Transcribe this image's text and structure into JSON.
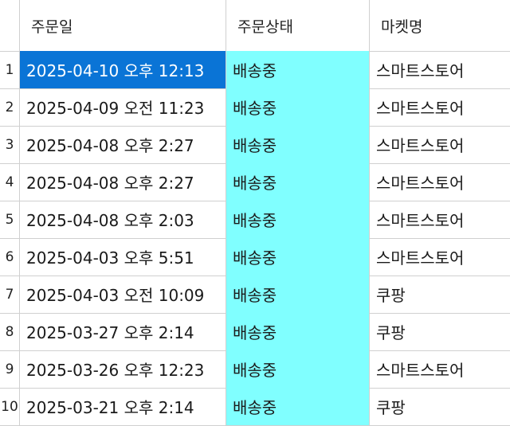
{
  "columns": {
    "index": "",
    "order_date": "주문일",
    "order_status": "주문상태",
    "market_name": "마켓명"
  },
  "selected_row": 0,
  "status_highlight_color": "#80ffff",
  "selection_color": "#0a74d6",
  "rows": [
    {
      "index": "1",
      "order_date": "2025-04-10 오후 12:13",
      "order_status": "배송중",
      "market_name": "스마트스토어"
    },
    {
      "index": "2",
      "order_date": "2025-04-09 오전 11:23",
      "order_status": "배송중",
      "market_name": "스마트스토어"
    },
    {
      "index": "3",
      "order_date": "2025-04-08 오후 2:27",
      "order_status": "배송중",
      "market_name": "스마트스토어"
    },
    {
      "index": "4",
      "order_date": "2025-04-08 오후 2:27",
      "order_status": "배송중",
      "market_name": "스마트스토어"
    },
    {
      "index": "5",
      "order_date": "2025-04-08 오후 2:03",
      "order_status": "배송중",
      "market_name": "스마트스토어"
    },
    {
      "index": "6",
      "order_date": "2025-04-03 오후 5:51",
      "order_status": "배송중",
      "market_name": "스마트스토어"
    },
    {
      "index": "7",
      "order_date": "2025-04-03 오전 10:09",
      "order_status": "배송중",
      "market_name": "쿠팡"
    },
    {
      "index": "8",
      "order_date": "2025-03-27 오후 2:14",
      "order_status": "배송중",
      "market_name": "쿠팡"
    },
    {
      "index": "9",
      "order_date": "2025-03-26 오후 12:23",
      "order_status": "배송중",
      "market_name": "스마트스토어"
    },
    {
      "index": "10",
      "order_date": "2025-03-21 오후 2:14",
      "order_status": "배송중",
      "market_name": "쿠팡"
    }
  ]
}
